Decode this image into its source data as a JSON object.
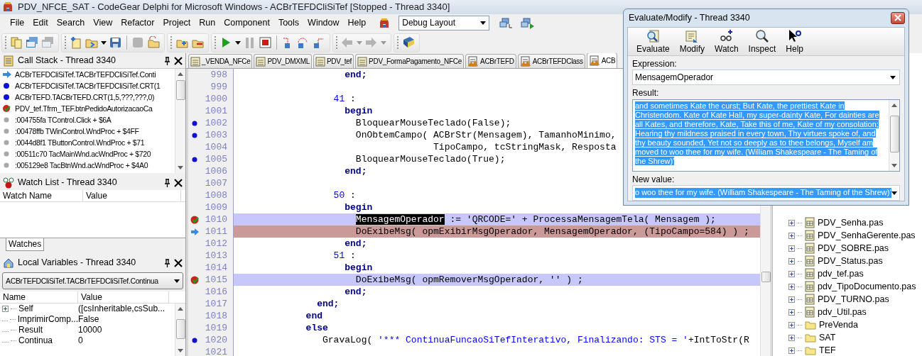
{
  "window": {
    "title": "PDV_NFCE_SAT - CodeGear Delphi for Microsoft Windows - ACBrTEFDCliSiTef [Stopped - Thread 3340]"
  },
  "menu": [
    "File",
    "Edit",
    "Search",
    "View",
    "Refactor",
    "Project",
    "Run",
    "Component",
    "Tools",
    "Window",
    "Help"
  ],
  "layout_combo": {
    "value": "Debug Layout"
  },
  "toolbar": [
    [
      {
        "kind": "pages",
        "disabled": false
      },
      {
        "kind": "window",
        "disabled": false
      },
      {
        "kind": "window",
        "disabled": true
      }
    ],
    [
      {
        "kind": "new",
        "disabled": false
      },
      {
        "kind": "open",
        "disabled": false
      },
      {
        "kind": "caret",
        "disabled": false
      },
      {
        "kind": "save",
        "disabled": false
      },
      {
        "kind": "separator"
      },
      {
        "kind": "blank",
        "disabled": true
      },
      {
        "kind": "folder-arrow",
        "disabled": false
      }
    ],
    [
      {
        "kind": "add-file",
        "disabled": false
      },
      {
        "kind": "remove-file",
        "disabled": false
      }
    ],
    [
      {
        "kind": "run",
        "disabled": false
      },
      {
        "kind": "caret",
        "disabled": false
      },
      {
        "kind": "pause",
        "disabled": true
      },
      {
        "kind": "stop",
        "disabled": false
      },
      {
        "kind": "separator"
      },
      {
        "kind": "trace-into",
        "disabled": false
      },
      {
        "kind": "step-over",
        "disabled": false
      },
      {
        "kind": "step-out",
        "disabled": false
      }
    ],
    [
      {
        "kind": "back",
        "disabled": true
      },
      {
        "kind": "caret",
        "disabled": true
      },
      {
        "kind": "forward",
        "disabled": true
      },
      {
        "kind": "caret",
        "disabled": true
      }
    ],
    [
      {
        "kind": "help-book",
        "disabled": false
      }
    ]
  ],
  "call_stack": {
    "title": "Call Stack - Thread 3340",
    "items": [
      {
        "kind": "current",
        "text": "ACBrTEFDCliSiTef.TACBrTEFDCliSiTef.Conti"
      },
      {
        "kind": "debug",
        "text": "ACBrTEFDCliSiTef.TACBrTEFDCliSiTef.CRT(1"
      },
      {
        "kind": "debug",
        "text": "ACBrTEFD.TACBrTEFD.CRT(1,5,???,???,0)"
      },
      {
        "kind": "breakpoint",
        "text": "PDV_tef.Tfrm_TEF.btnPedidoAutorizacaoCa"
      },
      {
        "kind": "nodebug",
        "text": ":004755fa TControl.Click + $6A"
      },
      {
        "kind": "nodebug",
        "text": ":00478ffb TWinControl.WndProc + $4FF"
      },
      {
        "kind": "nodebug",
        "text": ":0044d8f1 TButtonControl.WndProc + $71"
      },
      {
        "kind": "nodebug",
        "text": ":00511c70 TacMainWnd.acWndProc + $720"
      },
      {
        "kind": "nodebug",
        "text": ":005129e8 TacBtnWnd.acWndProc + $4A0"
      }
    ]
  },
  "watch_list": {
    "title": "Watch List - Thread 3340",
    "columns": [
      "Watch Name",
      "Value"
    ],
    "tabs": [
      {
        "label": "Watches",
        "selected": true
      }
    ]
  },
  "local_variables": {
    "title": "Local Variables - Thread 3340",
    "scope": "ACBrTEFDCliSiTef.TACBrTEFDCliSiTef.Continua",
    "columns": [
      "Name",
      "Value"
    ],
    "rows": [
      {
        "name": "Self",
        "value": "([csInheritable,csSub...",
        "expandable": true
      },
      {
        "name": "ImprimirComp...",
        "value": "False",
        "expandable": false
      },
      {
        "name": "Result",
        "value": "10000",
        "expandable": false
      },
      {
        "name": "Continua",
        "value": "0",
        "expandable": false
      }
    ]
  },
  "editor": {
    "tabs": [
      {
        "label": "_VENDA_NFCe",
        "kind": "form",
        "selected": false
      },
      {
        "label": "PDV_DMXML",
        "kind": "form",
        "selected": false
      },
      {
        "label": "PDV_tef",
        "kind": "form",
        "selected": false
      },
      {
        "label": "PDV_FormaPagamento_NFCe",
        "kind": "form",
        "selected": false
      },
      {
        "label": "ACBrTEFD",
        "kind": "unit",
        "selected": false
      },
      {
        "label": "ACBrTEFDClass",
        "kind": "unit",
        "selected": false
      },
      {
        "label": "ACB",
        "kind": "unit",
        "selected": true
      }
    ],
    "lines": [
      {
        "number": "998",
        "executable": false,
        "breakpoint": false,
        "current": false,
        "tokens": [
          {
            "kind": "keyword",
            "text": "                   end;"
          }
        ]
      },
      {
        "number": "999",
        "executable": false,
        "breakpoint": false,
        "current": false
      },
      {
        "number": "1000",
        "executable": false,
        "breakpoint": false,
        "current": false,
        "tokens": [
          {
            "kind": "number",
            "text": "                 41"
          },
          {
            "kind": "plain",
            "text": " :"
          }
        ]
      },
      {
        "number": "1001",
        "executable": false,
        "breakpoint": false,
        "current": false,
        "tokens": [
          {
            "kind": "keyword",
            "text": "                   begin"
          }
        ]
      },
      {
        "number": "1002",
        "executable": true,
        "breakpoint": false,
        "current": false,
        "tokens": [
          {
            "kind": "plain",
            "text": "                     BloquearMouseTeclado(False);"
          }
        ]
      },
      {
        "number": "1003",
        "executable": true,
        "breakpoint": false,
        "current": false,
        "tokens": [
          {
            "kind": "plain",
            "text": "                     OnObtemCampo( ACBrStr(Mensagem), TamanhoMinimo,"
          }
        ]
      },
      {
        "number": "1004",
        "executable": false,
        "breakpoint": false,
        "current": false,
        "tokens": [
          {
            "kind": "plain",
            "text": "                                   TipoCampo, tcStringMask, Resposta"
          }
        ]
      },
      {
        "number": "1005",
        "executable": true,
        "breakpoint": false,
        "current": false,
        "tokens": [
          {
            "kind": "plain",
            "text": "                     BloquearMouseTeclado(True);"
          }
        ]
      },
      {
        "number": "1006",
        "executable": false,
        "breakpoint": false,
        "current": false,
        "tokens": [
          {
            "kind": "keyword",
            "text": "                   end;"
          }
        ]
      },
      {
        "number": "1007",
        "executable": false,
        "breakpoint": false,
        "current": false
      },
      {
        "number": "1008",
        "executable": false,
        "breakpoint": false,
        "current": false,
        "tokens": [
          {
            "kind": "number",
            "text": "                 50"
          },
          {
            "kind": "plain",
            "text": " :"
          }
        ]
      },
      {
        "number": "1009",
        "executable": false,
        "breakpoint": false,
        "current": false,
        "tokens": [
          {
            "kind": "keyword",
            "text": "                   begin"
          }
        ]
      },
      {
        "number": "1010",
        "executable": true,
        "breakpoint": true,
        "current": false,
        "tokens": [
          {
            "kind": "selected",
            "text": "                     MensagemOperador"
          },
          {
            "kind": "plain",
            "text": " := 'QRCODE=' + ProcessaMensagemTela( Mensagem );"
          }
        ]
      },
      {
        "number": "1011",
        "executable": true,
        "breakpoint": false,
        "current": true,
        "tokens": [
          {
            "kind": "plain",
            "text": "                     DoExibeMsg( opmExibirMsgOperador, MensagemOperador, (TipoCampo=584) ) ;"
          }
        ]
      },
      {
        "number": "1012",
        "executable": false,
        "breakpoint": false,
        "current": false,
        "tokens": [
          {
            "kind": "keyword",
            "text": "                   end;"
          }
        ]
      },
      {
        "number": "1013",
        "executable": false,
        "breakpoint": false,
        "current": false,
        "tokens": [
          {
            "kind": "number",
            "text": "                 51"
          },
          {
            "kind": "plain",
            "text": " :"
          }
        ]
      },
      {
        "number": "1014",
        "executable": false,
        "breakpoint": false,
        "current": false,
        "tokens": [
          {
            "kind": "keyword",
            "text": "                   begin"
          }
        ]
      },
      {
        "number": "1015",
        "executable": true,
        "breakpoint": true,
        "current": false,
        "tokens": [
          {
            "kind": "plain",
            "text": "                     DoExibeMsg( opmRemoverMsgOperador, '' ) ;"
          }
        ]
      },
      {
        "number": "1016",
        "executable": false,
        "breakpoint": false,
        "current": false,
        "tokens": [
          {
            "kind": "keyword",
            "text": "                   end;"
          }
        ]
      },
      {
        "number": "1017",
        "executable": false,
        "breakpoint": false,
        "current": false,
        "tokens": [
          {
            "kind": "keyword",
            "text": "              end;"
          }
        ]
      },
      {
        "number": "1018",
        "executable": false,
        "breakpoint": false,
        "current": false,
        "tokens": [
          {
            "kind": "keyword",
            "text": "            end"
          }
        ]
      },
      {
        "number": "1019",
        "executable": false,
        "breakpoint": false,
        "current": false,
        "tokens": [
          {
            "kind": "keyword",
            "text": "            else"
          }
        ]
      },
      {
        "number": "1020",
        "executable": true,
        "breakpoint": false,
        "current": false,
        "tokens": [
          {
            "kind": "plain",
            "text": "               GravaLog( "
          },
          {
            "kind": "string",
            "text": "'*** ContinuaFuncaoSiTefInterativo, Finalizando: STS = '"
          },
          {
            "kind": "plain",
            "text": "+IntToStr(R"
          }
        ]
      },
      {
        "number": "1021",
        "executable": false,
        "breakpoint": false,
        "current": false
      }
    ]
  },
  "project_tree": {
    "items": [
      {
        "kind": "file",
        "label": "PDV_Senha.pas"
      },
      {
        "kind": "file",
        "label": "PDV_SenhaGerente.pas"
      },
      {
        "kind": "file",
        "label": "PDV_SOBRE.pas"
      },
      {
        "kind": "file",
        "label": "PDV_Status.pas"
      },
      {
        "kind": "file",
        "label": "pdv_tef.pas"
      },
      {
        "kind": "file",
        "label": "pdv_TipoDocumento.pas"
      },
      {
        "kind": "file",
        "label": "PDV_TURNO.pas"
      },
      {
        "kind": "file",
        "label": "pdv_Util.pas"
      },
      {
        "kind": "folder",
        "label": "PreVenda"
      },
      {
        "kind": "folder",
        "label": "SAT"
      },
      {
        "kind": "folder",
        "label": "TEF"
      }
    ]
  },
  "evaluate_dialog": {
    "title": "Evaluate/Modify - Thread 3340",
    "toolbar": [
      {
        "kind": "evaluate",
        "label": "Evaluate"
      },
      {
        "kind": "modify",
        "label": "Modify"
      },
      {
        "kind": "watch",
        "label": "Watch"
      },
      {
        "kind": "inspect",
        "label": "Inspect"
      },
      {
        "kind": "help",
        "label": "Help"
      }
    ],
    "expression_label": "Expression:",
    "expression": "MensagemOperador",
    "result_label": "Result:",
    "result": {
      "text": "and sometimes Kate the curst; But Kate, the prettiest Kate in Christendom. Kate of Kate Hall, my super-dainty Kate, For dainties are all Kates, and therefore, Kate, Take this of me, Kate of my consolation; Hearing thy mildness praised in every town, Thy virtues spoke of, and thy beauty sounded, Yet not so deeply as to thee belongs, Myself am moved to woo thee for my wife. (William Shakespeare - The Taming of the Shrew)'",
      "selected": true
    },
    "new_value_label": "New value:",
    "new_value": {
      "text": "o woo thee for my wife. (William Shakespeare - The Taming of the Shrew)'",
      "selected": true
    }
  }
}
